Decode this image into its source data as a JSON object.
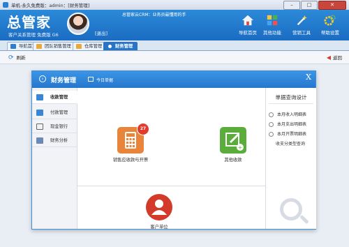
{
  "window": {
    "title": "单机-永久免费版：admin：[财务管理]"
  },
  "header": {
    "brand": "总管家",
    "subtitle": "客户关系管理 免费版 G6",
    "logout": "[退出]",
    "notice": "总管家云CRM：业务员最懂用的手",
    "buttons": [
      {
        "label": "导航首页",
        "icon": "home-icon"
      },
      {
        "label": "其他功能",
        "icon": "apps-icon"
      },
      {
        "label": "营销工具",
        "icon": "magic-wand-icon"
      },
      {
        "label": "帮助设置",
        "icon": "settings-icon"
      }
    ]
  },
  "tabs": [
    {
      "label": "导航首页"
    },
    {
      "label": "团队销售管理"
    },
    {
      "label": "仓库管理"
    },
    {
      "label": "财务管理",
      "active": true
    }
  ],
  "toolbar": {
    "refresh": "刷新",
    "back": "返回"
  },
  "modal": {
    "title": "财务管理",
    "subtitle": "今日单据",
    "close": "X",
    "sidebar": [
      {
        "label": "收款管理",
        "active": true
      },
      {
        "label": "付款管理"
      },
      {
        "label": "现金银行"
      },
      {
        "label": "财务分析"
      }
    ],
    "tiles": [
      {
        "label": "销售应收款与开票",
        "badge": "27",
        "color": "#e8853a"
      },
      {
        "label": "其他收款",
        "color": "#5aad3a"
      },
      {
        "label": "客户单位",
        "color": "#d33a2a"
      }
    ],
    "right": {
      "title": "单据查询设计",
      "items": [
        "本月收入明细表",
        "本月支出明细表",
        "本月开票明细表",
        "收支分类型查询"
      ]
    }
  }
}
